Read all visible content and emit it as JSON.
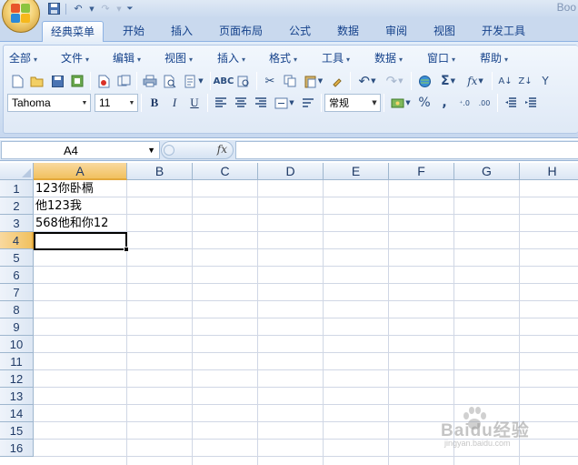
{
  "window": {
    "title": "Boo"
  },
  "quick_access": [
    {
      "icon": "save-icon",
      "glyph": "💾"
    },
    {
      "icon": "undo-icon",
      "glyph": "↶"
    },
    {
      "icon": "redo-icon",
      "glyph": "↷"
    }
  ],
  "tabs": [
    {
      "label": "经典菜单",
      "active": true
    },
    {
      "label": "开始"
    },
    {
      "label": "插入"
    },
    {
      "label": "页面布局"
    },
    {
      "label": "公式"
    },
    {
      "label": "数据"
    },
    {
      "label": "审阅"
    },
    {
      "label": "视图"
    },
    {
      "label": "开发工具"
    }
  ],
  "menus": [
    "全部",
    "文件",
    "编辑",
    "视图",
    "插入",
    "格式",
    "工具",
    "数据",
    "窗口",
    "帮助"
  ],
  "format_bar": {
    "font_name": "Tahoma",
    "font_size": "11",
    "bold": "B",
    "italic": "I",
    "underline": "U",
    "number_format": "常规",
    "percent": "%",
    "comma": ","
  },
  "formula_bar": {
    "name_box": "A4",
    "fx_label": "fx",
    "formula": ""
  },
  "grid": {
    "columns": [
      "A",
      "B",
      "C",
      "D",
      "E",
      "F",
      "G",
      "H"
    ],
    "rows": [
      "1",
      "2",
      "3",
      "4",
      "5",
      "6",
      "7",
      "8",
      "9",
      "10",
      "11",
      "12",
      "13",
      "14",
      "15",
      "16"
    ],
    "selected_column": "A",
    "selected_row": "4",
    "cells": [
      {
        "ref": "A1",
        "value": "123你卧槅"
      },
      {
        "ref": "A2",
        "value": "他123我"
      },
      {
        "ref": "A3",
        "value": "568他和你12"
      }
    ]
  },
  "watermark": {
    "brand": "Baidu经验",
    "url": "jingyan.baidu.com"
  }
}
